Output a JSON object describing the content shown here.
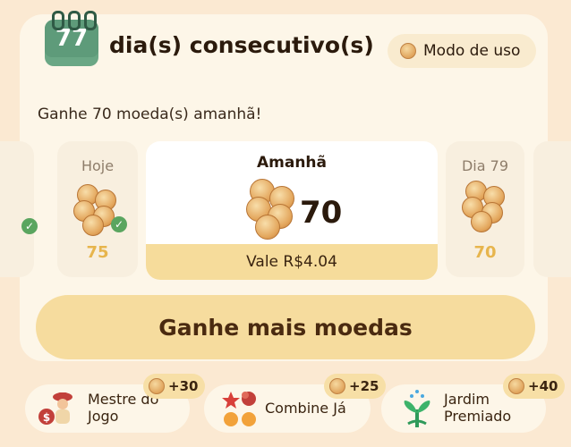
{
  "streak": {
    "days": "77",
    "title": "dia(s) consecutivo(s)"
  },
  "howto": {
    "label": "Modo de uso",
    "icon": "coin-icon"
  },
  "subtitle": "Ganhe 70 moeda(s) amanhã!",
  "days": {
    "today": {
      "label": "Hoje",
      "amount": "75",
      "claimed": true
    },
    "tomorrow": {
      "label": "Amanhã",
      "amount": "70",
      "worth": "Vale R$4.04"
    },
    "day79": {
      "label": "Dia 79",
      "amount": "70"
    }
  },
  "earn_button": "Ganhe mais moedas",
  "games": [
    {
      "name_line1": "Mestre do",
      "name_line2": "Jogo",
      "reward": "+30",
      "icon": "game-master-icon"
    },
    {
      "name_line1": "Combine Já",
      "name_line2": "",
      "reward": "+25",
      "icon": "match-game-icon"
    },
    {
      "name_line1": "Jardim",
      "name_line2": "Premiado",
      "reward": "+40",
      "icon": "garden-icon"
    }
  ],
  "colors": {
    "accent": "#f6dc9e",
    "calendar": "#5e9b7a",
    "check": "#5aa55f",
    "amount": "#e7b54d"
  }
}
